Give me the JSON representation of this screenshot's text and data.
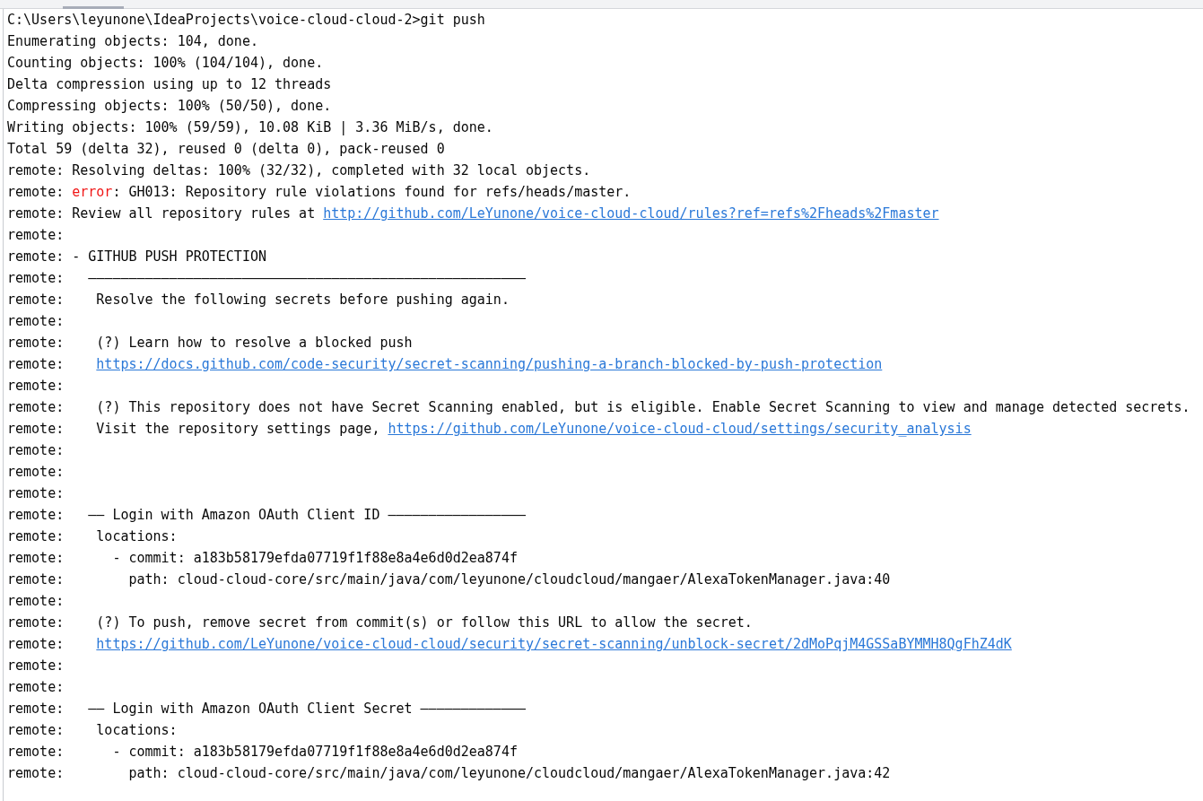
{
  "terminal": {
    "lines": [
      [
        {
          "kind": "text",
          "text": "C:\\Users\\leyunone\\IdeaProjects\\voice-cloud-cloud-2>git push"
        }
      ],
      [
        {
          "kind": "text",
          "text": "Enumerating objects: 104, done."
        }
      ],
      [
        {
          "kind": "text",
          "text": "Counting objects: 100% (104/104), done."
        }
      ],
      [
        {
          "kind": "text",
          "text": "Delta compression using up to 12 threads"
        }
      ],
      [
        {
          "kind": "text",
          "text": "Compressing objects: 100% (50/50), done."
        }
      ],
      [
        {
          "kind": "text",
          "text": "Writing objects: 100% (59/59), 10.08 KiB | 3.36 MiB/s, done."
        }
      ],
      [
        {
          "kind": "text",
          "text": "Total 59 (delta 32), reused 0 (delta 0), pack-reused 0"
        }
      ],
      [
        {
          "kind": "text",
          "text": "remote: Resolving deltas: 100% (32/32), completed with 32 local objects."
        }
      ],
      [
        {
          "kind": "text",
          "text": "remote: "
        },
        {
          "kind": "error",
          "text": "error"
        },
        {
          "kind": "text",
          "text": ": GH013: Repository rule violations found for refs/heads/master."
        }
      ],
      [
        {
          "kind": "text",
          "text": "remote: Review all repository rules at "
        },
        {
          "kind": "link",
          "text": "http://github.com/LeYunone/voice-cloud-cloud/rules?ref=refs%2Fheads%2Fmaster"
        }
      ],
      [
        {
          "kind": "text",
          "text": "remote:"
        }
      ],
      [
        {
          "kind": "text",
          "text": "remote: - GITHUB PUSH PROTECTION"
        }
      ],
      [
        {
          "kind": "text",
          "text": "remote:   ——————————————————————————————————————————————————————"
        }
      ],
      [
        {
          "kind": "text",
          "text": "remote:    Resolve the following secrets before pushing again."
        }
      ],
      [
        {
          "kind": "text",
          "text": "remote:"
        }
      ],
      [
        {
          "kind": "text",
          "text": "remote:    (?) Learn how to resolve a blocked push"
        }
      ],
      [
        {
          "kind": "text",
          "text": "remote:    "
        },
        {
          "kind": "link",
          "text": "https://docs.github.com/code-security/secret-scanning/pushing-a-branch-blocked-by-push-protection"
        }
      ],
      [
        {
          "kind": "text",
          "text": "remote:"
        }
      ],
      [
        {
          "kind": "text",
          "text": "remote:    (?) This repository does not have Secret Scanning enabled, but is eligible. Enable Secret Scanning to view and manage detected secrets."
        }
      ],
      [
        {
          "kind": "text",
          "text": "remote:    Visit the repository settings page, "
        },
        {
          "kind": "link",
          "text": "https://github.com/LeYunone/voice-cloud-cloud/settings/security_analysis"
        }
      ],
      [
        {
          "kind": "text",
          "text": "remote:"
        }
      ],
      [
        {
          "kind": "text",
          "text": "remote:"
        }
      ],
      [
        {
          "kind": "text",
          "text": "remote:"
        }
      ],
      [
        {
          "kind": "text",
          "text": "remote:   —— Login with Amazon OAuth Client ID —————————————————"
        }
      ],
      [
        {
          "kind": "text",
          "text": "remote:    locations:"
        }
      ],
      [
        {
          "kind": "text",
          "text": "remote:      - commit: a183b58179efda07719f1f88e8a4e6d0d2ea874f"
        }
      ],
      [
        {
          "kind": "text",
          "text": "remote:        path: cloud-cloud-core/src/main/java/com/leyunone/cloudcloud/mangaer/AlexaTokenManager.java:40"
        }
      ],
      [
        {
          "kind": "text",
          "text": "remote:"
        }
      ],
      [
        {
          "kind": "text",
          "text": "remote:    (?) To push, remove secret from commit(s) or follow this URL to allow the secret."
        }
      ],
      [
        {
          "kind": "text",
          "text": "remote:    "
        },
        {
          "kind": "link",
          "text": "https://github.com/LeYunone/voice-cloud-cloud/security/secret-scanning/unblock-secret/2dMoPqjM4GSSaBYMMH8QgFhZ4dK"
        }
      ],
      [
        {
          "kind": "text",
          "text": "remote:"
        }
      ],
      [
        {
          "kind": "text",
          "text": "remote:"
        }
      ],
      [
        {
          "kind": "text",
          "text": "remote:   —— Login with Amazon OAuth Client Secret —————————————"
        }
      ],
      [
        {
          "kind": "text",
          "text": "remote:    locations:"
        }
      ],
      [
        {
          "kind": "text",
          "text": "remote:      - commit: a183b58179efda07719f1f88e8a4e6d0d2ea874f"
        }
      ],
      [
        {
          "kind": "text",
          "text": "remote:        path: cloud-cloud-core/src/main/java/com/leyunone/cloudcloud/mangaer/AlexaTokenManager.java:42"
        }
      ]
    ]
  }
}
